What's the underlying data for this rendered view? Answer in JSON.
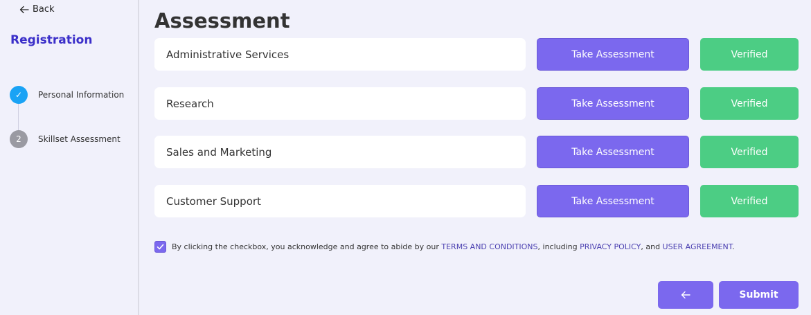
{
  "sidebar": {
    "back_label": "Back",
    "title": "Registration",
    "steps": [
      {
        "marker": "✓",
        "label": "Personal Information",
        "status": "done"
      },
      {
        "marker": "2",
        "label": "Skillset Assessment",
        "status": "pending"
      }
    ]
  },
  "main": {
    "title": "Assessment",
    "assessments": [
      {
        "name": "Administrative Services",
        "action_label": "Take Assessment",
        "status_label": "Verified"
      },
      {
        "name": "Research",
        "action_label": "Take Assessment",
        "status_label": "Verified"
      },
      {
        "name": "Sales and Marketing",
        "action_label": "Take Assessment",
        "status_label": "Verified"
      },
      {
        "name": "Customer Support",
        "action_label": "Take Assessment",
        "status_label": "Verified"
      }
    ],
    "agreement": {
      "checked": true,
      "text_before": "By clicking the checkbox, you acknowledge and agree to abide by our ",
      "terms_link": "TERMS AND CONDITIONS",
      "text_mid1": ", including ",
      "privacy_link": "PRIVACY POLICY",
      "text_mid2": ", and ",
      "user_link": "USER AGREEMENT",
      "text_after": "."
    },
    "footer": {
      "prev_icon": "arrow-left-icon",
      "submit_label": "Submit"
    }
  },
  "colors": {
    "accent": "#7b68ee",
    "verified": "#4ccd84",
    "title_accent": "#3b2fc9",
    "step_done": "#1aa3f5",
    "step_pending": "#9a9aa2",
    "background": "#f1f1fb"
  }
}
